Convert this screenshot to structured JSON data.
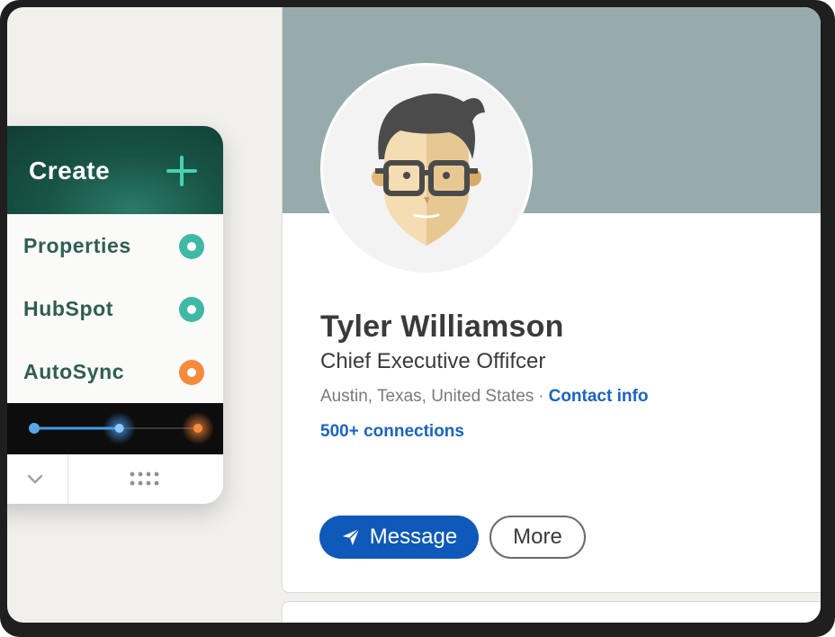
{
  "profile": {
    "name": "Tyler Williamson",
    "title": "Chief Executive Offifcer",
    "location": "Austin, Texas, United States",
    "separator": "·",
    "contact_link": "Contact info",
    "connections": "500+ connections",
    "buttons": {
      "message": "Message",
      "more": "More"
    },
    "avatar_icon": "avatar-illustration",
    "colors": {
      "cover": "#97abad",
      "link": "#1a64c2",
      "primary_button": "#0e59b9"
    }
  },
  "create_widget": {
    "header": {
      "label": "Create",
      "icon": "plus-icon",
      "accent": "#46d3b1"
    },
    "items": [
      {
        "label": "Properties",
        "status_color": "#3fb9a5"
      },
      {
        "label": "HubSpot",
        "status_color": "#3fb9a5"
      },
      {
        "label": "AutoSync",
        "status_color": "#f58a3b"
      }
    ],
    "slider": {
      "level": 0.52,
      "start_color": "#5aa6e6",
      "end_color": "#f58a3b"
    },
    "footer": {
      "left_icon": "chevron-down-icon",
      "right_icon": "grid-dots-icon"
    }
  }
}
